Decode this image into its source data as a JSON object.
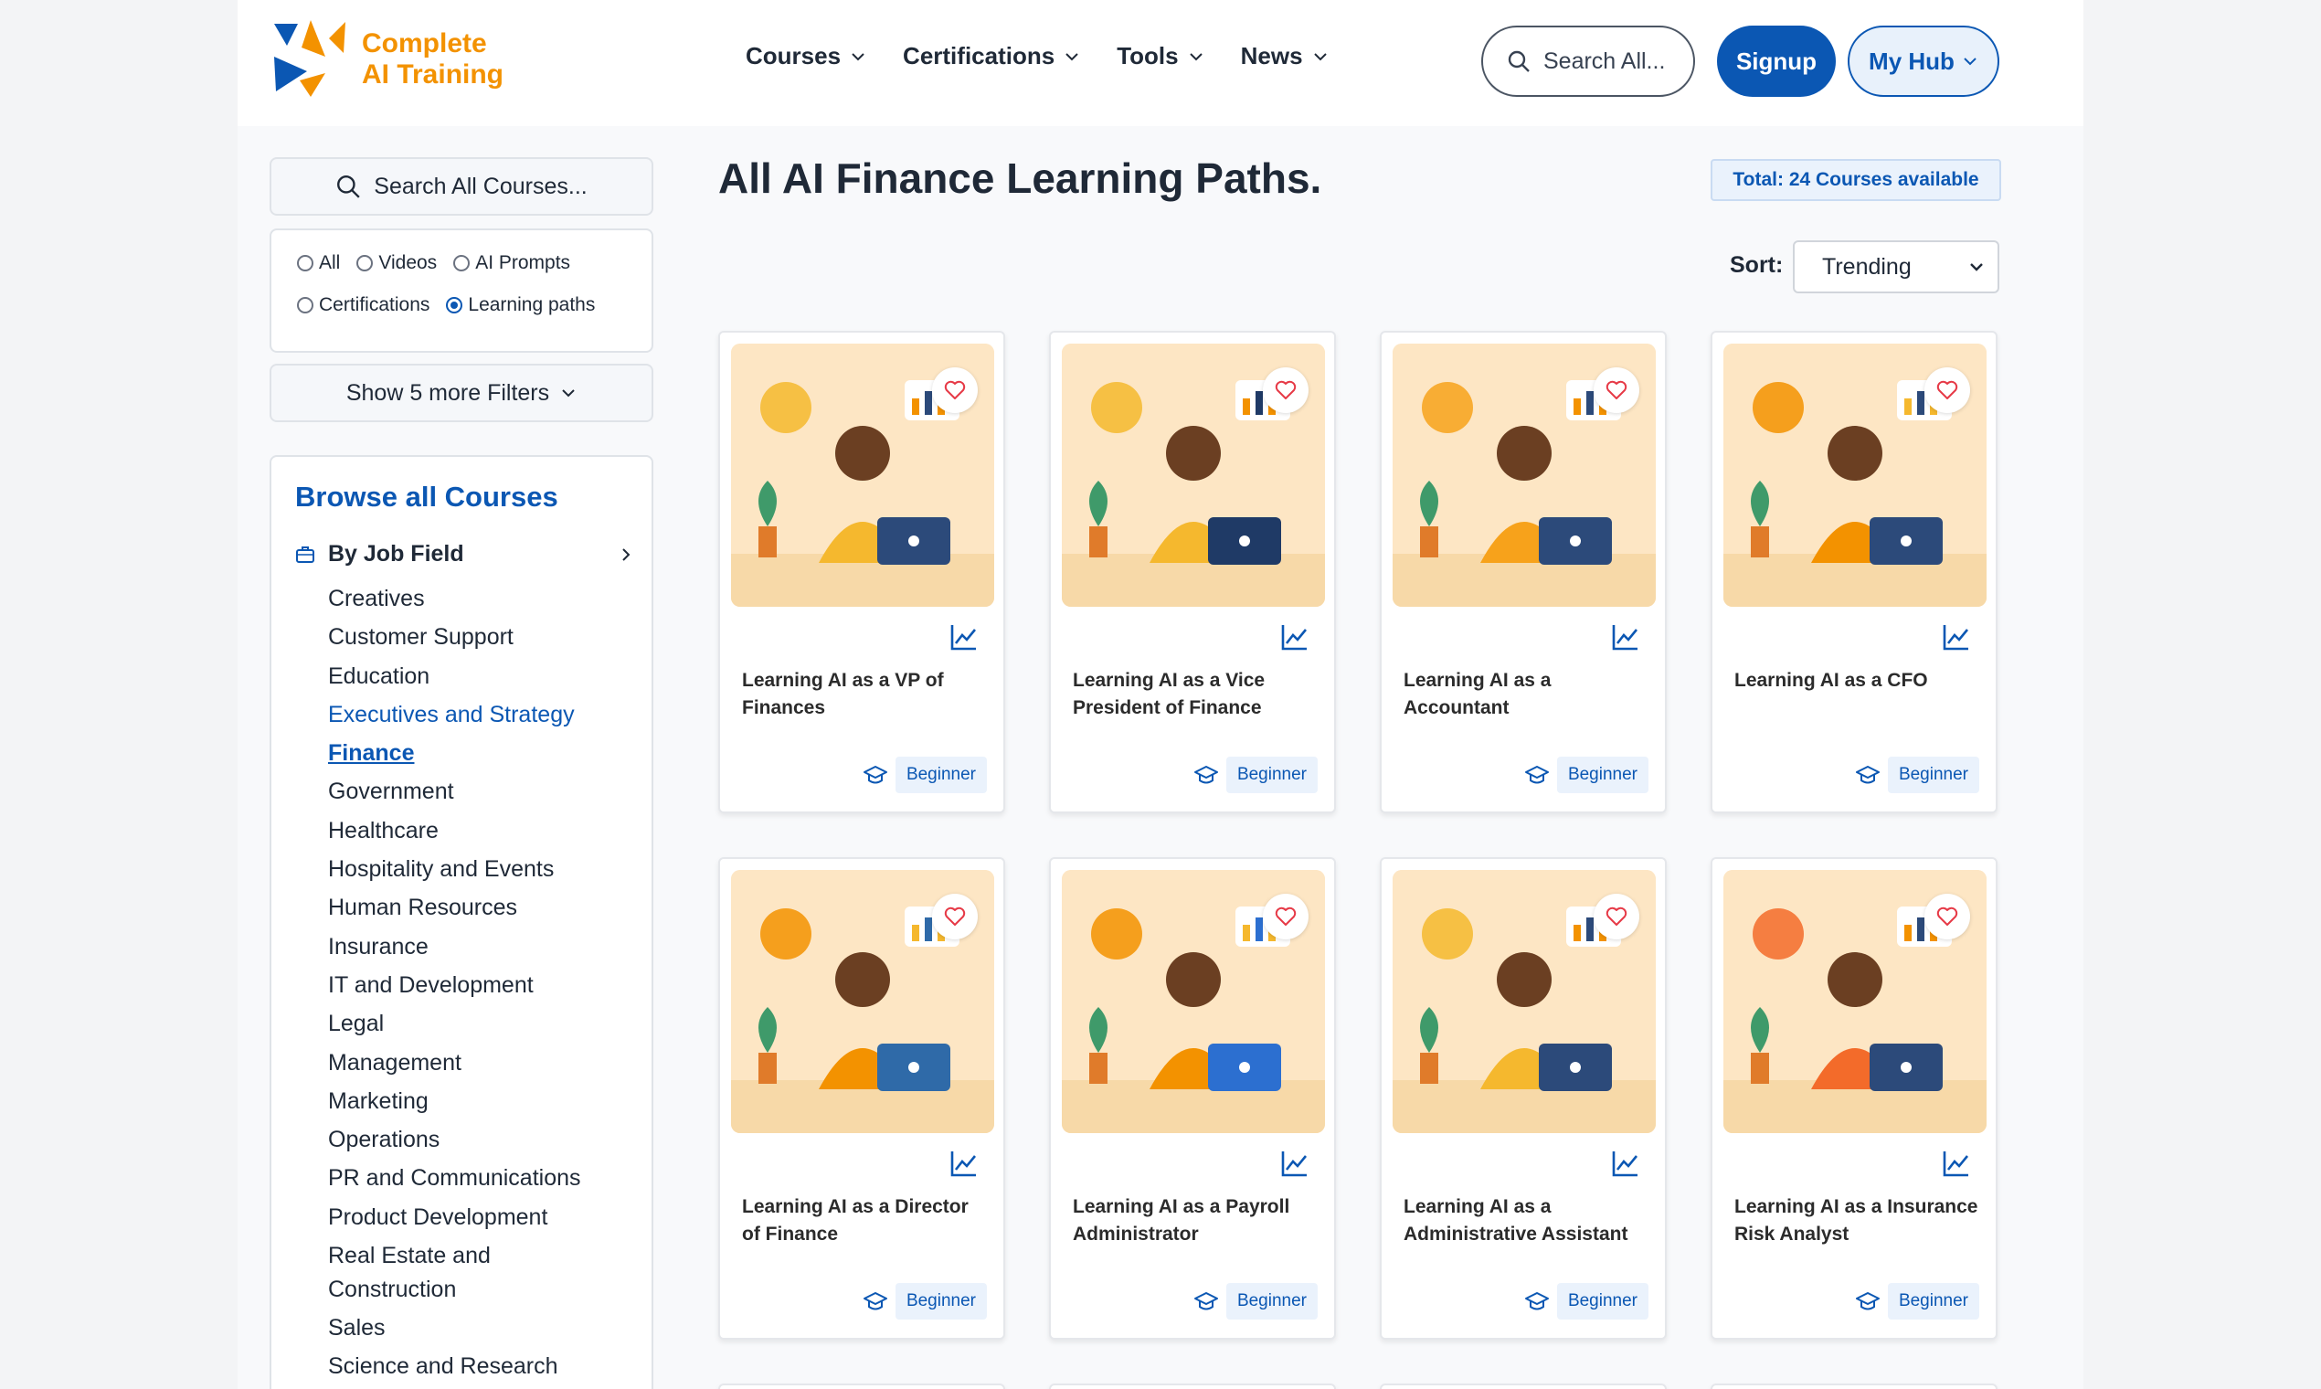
{
  "brand": {
    "line1": "Complete",
    "line2": "AI Training",
    "color": "#f39200"
  },
  "nav": [
    {
      "label": "Courses"
    },
    {
      "label": "Certifications"
    },
    {
      "label": "Tools"
    },
    {
      "label": "News"
    }
  ],
  "header": {
    "search_label": "Search All...",
    "signup": "Signup",
    "myhub": "My Hub"
  },
  "sidebar": {
    "search_label": "Search All Courses...",
    "filters": [
      {
        "label": "All",
        "checked": false
      },
      {
        "label": "Videos",
        "checked": false
      },
      {
        "label": "AI Prompts",
        "checked": false
      },
      {
        "label": "Certifications",
        "checked": false
      },
      {
        "label": "Learning paths",
        "checked": true
      }
    ],
    "more_filters": "Show 5 more Filters",
    "browse_title": "Browse all Courses",
    "job_field": "By Job Field",
    "categories": [
      "Creatives",
      "Customer Support",
      "Education",
      "Executives and Strategy",
      "Finance",
      "Government",
      "Healthcare",
      "Hospitality and Events",
      "Human Resources",
      "Insurance",
      "IT and Development",
      "Legal",
      "Management",
      "Marketing",
      "Operations",
      "PR and Communications",
      "Product Development",
      "Real Estate and Construction",
      "Sales",
      "Science and Research"
    ],
    "current_category": "Finance",
    "highlight_category": "Executives and Strategy"
  },
  "main": {
    "title": "All AI Finance Learning Paths.",
    "total": "Total: 24 Courses available",
    "sort_label": "Sort:",
    "sort_value": "Trending",
    "cards": [
      {
        "title": "Learning AI as a VP of Finances",
        "level": "Beginner"
      },
      {
        "title": "Learning AI as a Vice President of Finance",
        "level": "Beginner"
      },
      {
        "title": "Learning AI as a Accountant",
        "level": "Beginner"
      },
      {
        "title": "Learning AI as a CFO",
        "level": "Beginner"
      },
      {
        "title": "Learning AI as a Director of Finance",
        "level": "Beginner"
      },
      {
        "title": "Learning AI as a Payroll Administrator",
        "level": "Beginner"
      },
      {
        "title": "Learning AI as a Administrative Assistant",
        "level": "Beginner"
      },
      {
        "title": "Learning AI as a Insurance Risk Analyst",
        "level": "Beginner"
      }
    ]
  },
  "colors": {
    "primary": "#0b57b3",
    "accent": "#f39200",
    "heart": "#e63946"
  },
  "icons": [
    "logo-icon",
    "chevron-down-icon",
    "search-icon",
    "briefcase-icon",
    "chevron-right-icon",
    "heart-icon",
    "trend-chart-icon",
    "graduation-cap-icon"
  ]
}
